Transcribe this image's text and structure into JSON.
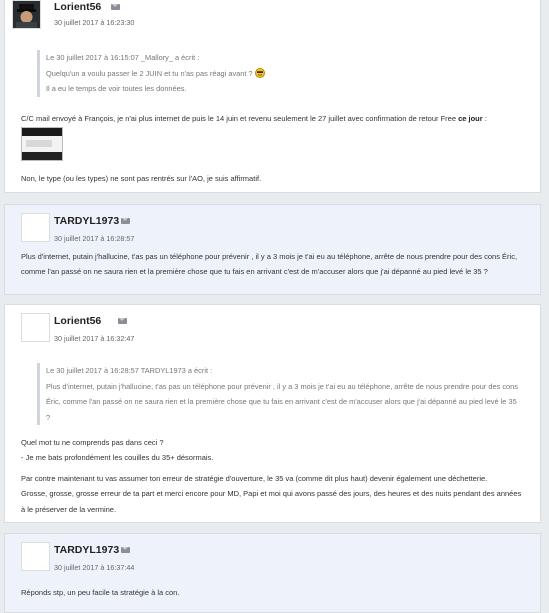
{
  "posts": [
    {
      "author": "Lorient56",
      "date": "30 juillet 2017 à 16:23:30",
      "quote": [
        "Le 30 juillet 2017 à 16:15:07 _Mallory_ a écrit :",
        "Quelqu'un a voulu passer le 2 JUIN et tu n'as pas réagi avant ?",
        "Il a eu le temps de voir toutes les données."
      ],
      "body": [
        "C/C mail envoyé à François, je n'ai plus internet de puis le 14 juin et revenu seulement le 27 juillet avec confirmation de retour Free",
        "ce jour",
        " :",
        "Non, le type (ou les types) ne sont pas rentrés sur l'AO, je suis affirmatif."
      ]
    },
    {
      "author": "TARDYL1973",
      "date": "30 juillet 2017 à 16:28:57",
      "body": [
        "Plus d'internet, putain j'hallucine, t'as pas un téléphone pour prévenir , il y a 3 mois je t'ai eu au téléphone, arrête de nous prendre pour des cons Éric,",
        "comme l'an passé on ne saura rien et la première chose que tu fais en arrivant c'est de m'accuser alors que j'ai dépanné au pied levé le 35 ?"
      ]
    },
    {
      "author": "Lorient56",
      "date": "30 juillet 2017 à 16:32:47",
      "quote": [
        "Le 30 juillet 2017 à 16:28:57 TARDYL1973 a écrit :",
        "Plus d'internet, putain j'hallucine, t'as pas un téléphone pour prévenir , il y a 3 mois je t'ai eu au téléphone, arrête de nous prendre pour des cons",
        "Éric, comme l'an passé on ne saura rien et la première chose que tu fais en arrivant c'est de m'accuser alors que j'ai dépanné au pied levé le 35",
        "?"
      ],
      "body": [
        "Quel mot tu ne comprends pas dans ceci ?",
        "- Je me bats profondément les couilles du 35+ désormais.",
        "Par contre maintenant tu vas assumer ton erreur de stratégie d'ouverture, le 35 va (comme dit plus haut) devenir également une déchetterie.",
        "Grosse, grosse, grosse erreur de ta part et merci encore pour MD, Papi et moi qui avons passé des jours, des heures et des nuits pendant des années",
        "à le préserver de la vermine."
      ]
    },
    {
      "author": "TARDYL1973",
      "date": "30 juillet 2017 à 16:37:44",
      "body": [
        "Réponds stp, un peu facile ta stratégie à la con."
      ]
    }
  ],
  "icons": {
    "mail": "envelope-icon",
    "smiley": "smiley-icon"
  },
  "colors": {
    "alt_post_bg": "#eef3fb",
    "page_bg": "#e9ecef"
  }
}
